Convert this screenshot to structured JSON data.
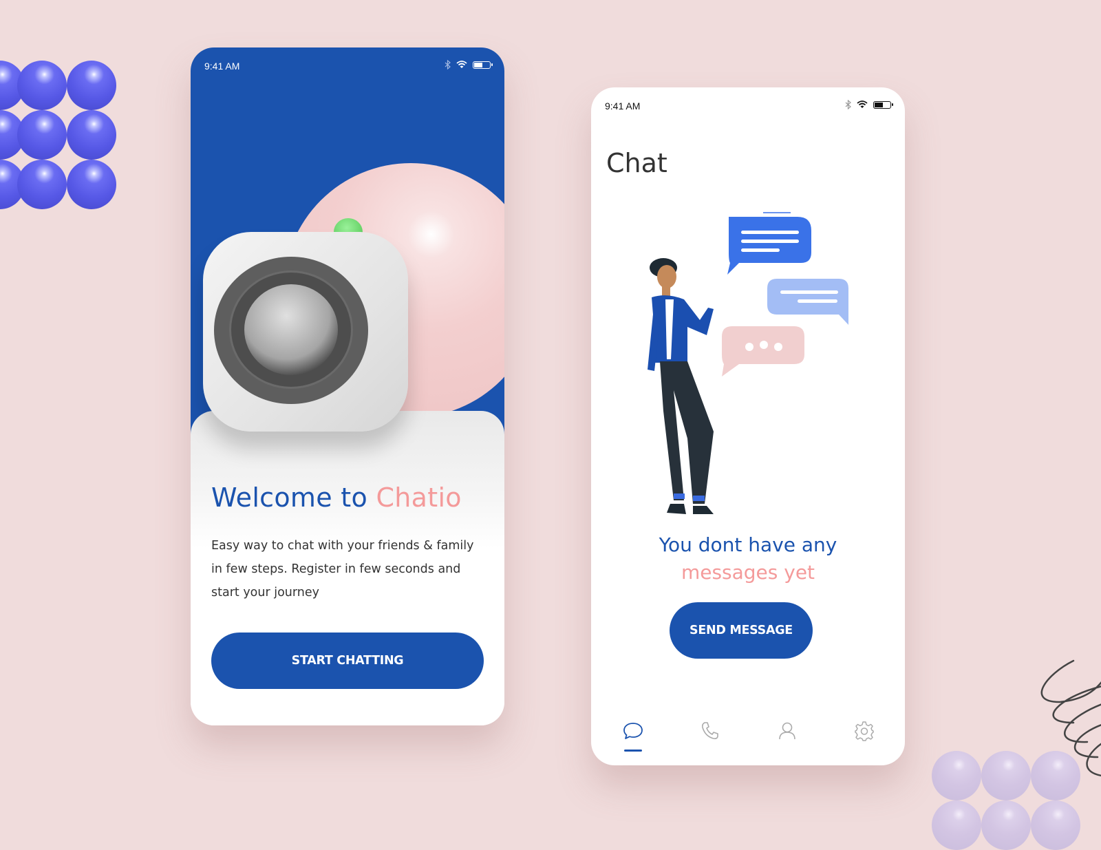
{
  "theme": {
    "brand_blue": "#1b53ae",
    "accent_pink": "#f49a9a",
    "background": "#f0dcdc"
  },
  "welcome_screen": {
    "status_bar": {
      "time": "9:41 AM",
      "icons": [
        "bluetooth-icon",
        "wifi-icon",
        "battery-icon"
      ]
    },
    "title_prefix": "Welcome to ",
    "title_brand": "Chatio",
    "description": "Easy way to chat with your friends & family in few steps. Register in few seconds and start your journey",
    "cta_label": "START CHATTING"
  },
  "chat_screen": {
    "status_bar": {
      "time": "9:41 AM",
      "icons": [
        "bluetooth-icon",
        "wifi-icon",
        "battery-icon"
      ]
    },
    "title": "Chat",
    "empty_line1": "You dont have any",
    "empty_line2": "messages yet",
    "cta_label": "SEND MESSAGE",
    "bottom_nav": [
      {
        "name": "chat",
        "icon": "chat-bubble-icon",
        "active": true
      },
      {
        "name": "calls",
        "icon": "phone-icon",
        "active": false
      },
      {
        "name": "profile",
        "icon": "user-icon",
        "active": false
      },
      {
        "name": "settings",
        "icon": "gear-icon",
        "active": false
      }
    ]
  }
}
